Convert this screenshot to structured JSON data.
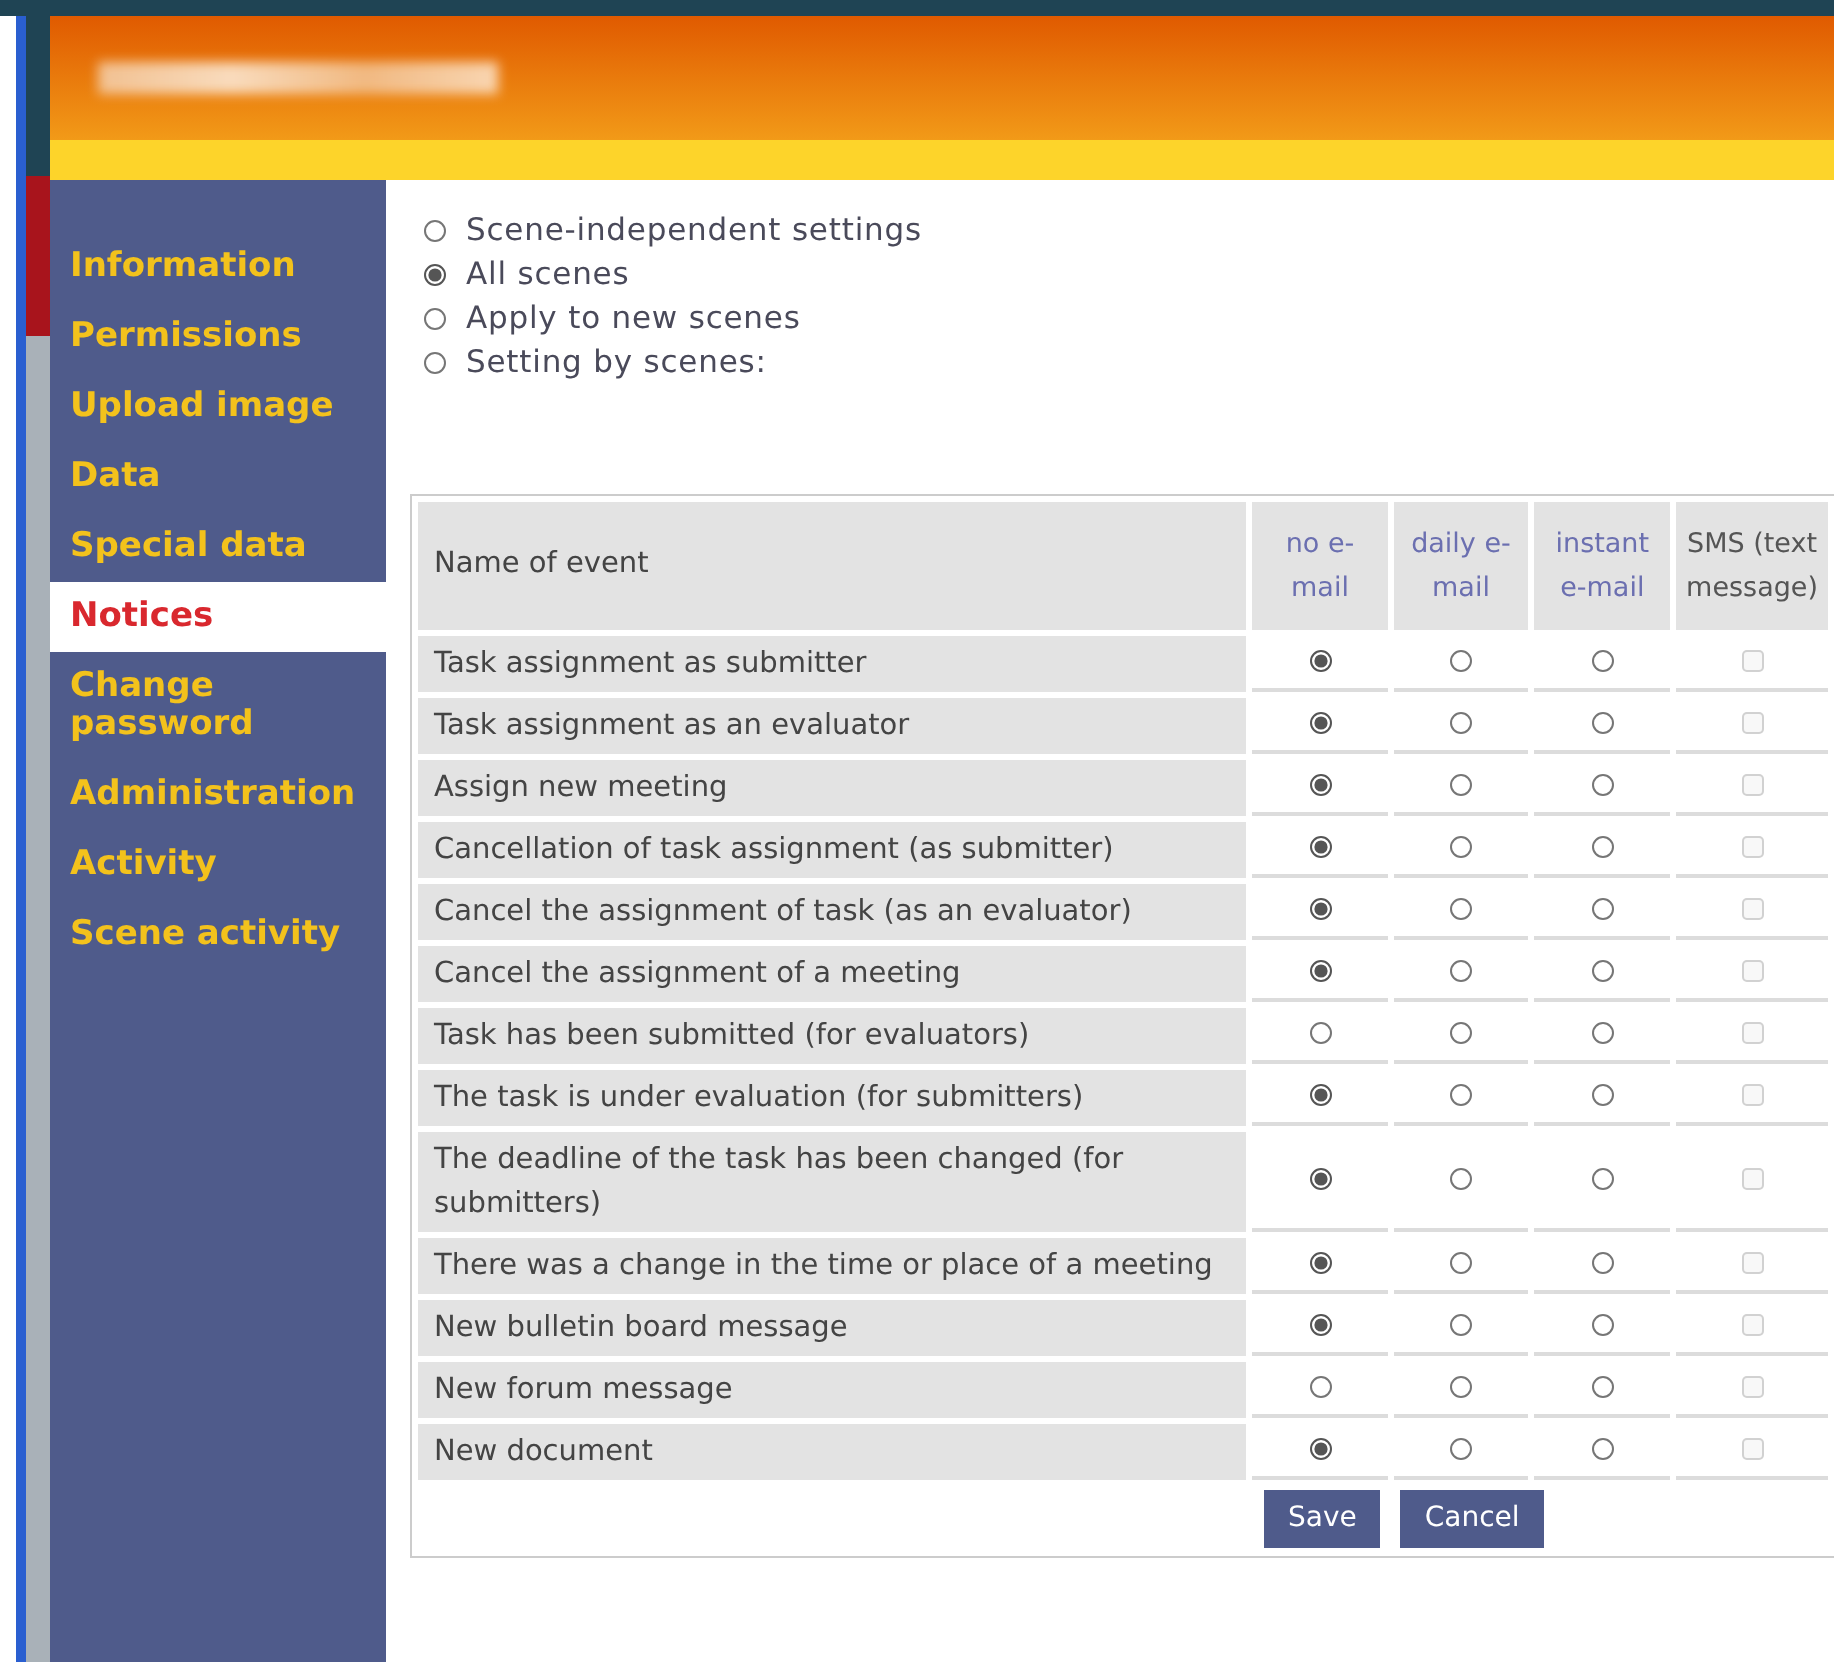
{
  "sidebar": {
    "items": [
      {
        "label": "Information",
        "selected": false
      },
      {
        "label": "Permissions",
        "selected": false
      },
      {
        "label": "Upload image",
        "selected": false
      },
      {
        "label": "Data",
        "selected": false
      },
      {
        "label": "Special data",
        "selected": false
      },
      {
        "label": "Notices",
        "selected": true
      },
      {
        "label": "Change password",
        "selected": false
      },
      {
        "label": "Administration",
        "selected": false
      },
      {
        "label": "Activity",
        "selected": false
      },
      {
        "label": "Scene activity",
        "selected": false
      }
    ]
  },
  "scene_options": [
    {
      "label": "Scene-independent settings",
      "selected": false
    },
    {
      "label": "All scenes",
      "selected": true
    },
    {
      "label": "Apply to new scenes",
      "selected": false
    },
    {
      "label": "Setting by scenes:",
      "selected": false
    }
  ],
  "table": {
    "columns": [
      "Name of event",
      "no e-mail",
      "daily e-mail",
      "instant e-mail",
      "SMS (text message)"
    ],
    "rows": [
      {
        "event": "Task assignment as submitter",
        "email_options": [
          {
            "selected": true
          },
          {
            "selected": false
          },
          {
            "selected": false
          }
        ],
        "sms": {
          "checked": false,
          "disabled": true
        }
      },
      {
        "event": "Task assignment as an evaluator",
        "email_options": [
          {
            "selected": true
          },
          {
            "selected": false
          },
          {
            "selected": false
          }
        ],
        "sms": {
          "checked": false,
          "disabled": true
        }
      },
      {
        "event": "Assign new meeting",
        "email_options": [
          {
            "selected": true
          },
          {
            "selected": false
          },
          {
            "selected": false
          }
        ],
        "sms": {
          "checked": false,
          "disabled": true
        }
      },
      {
        "event": "Cancellation of task assignment (as submitter)",
        "email_options": [
          {
            "selected": true
          },
          {
            "selected": false
          },
          {
            "selected": false
          }
        ],
        "sms": {
          "checked": false,
          "disabled": true
        }
      },
      {
        "event": "Cancel the assignment of task (as an evaluator)",
        "email_options": [
          {
            "selected": true
          },
          {
            "selected": false
          },
          {
            "selected": false
          }
        ],
        "sms": {
          "checked": false,
          "disabled": true
        }
      },
      {
        "event": "Cancel the assignment of a meeting",
        "email_options": [
          {
            "selected": true
          },
          {
            "selected": false
          },
          {
            "selected": false
          }
        ],
        "sms": {
          "checked": false,
          "disabled": true
        }
      },
      {
        "event": "Task has been submitted (for evaluators)",
        "email_options": [
          {
            "selected": false
          },
          {
            "selected": false
          },
          {
            "selected": false
          }
        ],
        "sms": {
          "checked": false,
          "disabled": true
        }
      },
      {
        "event": "The task is under evaluation (for submitters)",
        "email_options": [
          {
            "selected": true
          },
          {
            "selected": false
          },
          {
            "selected": false
          }
        ],
        "sms": {
          "checked": false,
          "disabled": true
        }
      },
      {
        "event": "The deadline of the task has been changed (for submitters)",
        "email_options": [
          {
            "selected": true
          },
          {
            "selected": false
          },
          {
            "selected": false
          }
        ],
        "sms": {
          "checked": false,
          "disabled": true
        }
      },
      {
        "event": "There was a change in the time or place of a meeting",
        "email_options": [
          {
            "selected": true
          },
          {
            "selected": false
          },
          {
            "selected": false
          }
        ],
        "sms": {
          "checked": false,
          "disabled": true
        }
      },
      {
        "event": "New bulletin board message",
        "email_options": [
          {
            "selected": true
          },
          {
            "selected": false
          },
          {
            "selected": false
          }
        ],
        "sms": {
          "checked": false,
          "disabled": true
        }
      },
      {
        "event": "New forum message",
        "email_options": [
          {
            "selected": false
          },
          {
            "selected": false
          },
          {
            "selected": false
          }
        ],
        "sms": {
          "checked": false,
          "disabled": true
        }
      },
      {
        "event": "New document",
        "email_options": [
          {
            "selected": true
          },
          {
            "selected": false
          },
          {
            "selected": false
          }
        ],
        "sms": {
          "checked": false,
          "disabled": true
        }
      }
    ]
  },
  "buttons": [
    "Save",
    "Cancel"
  ]
}
